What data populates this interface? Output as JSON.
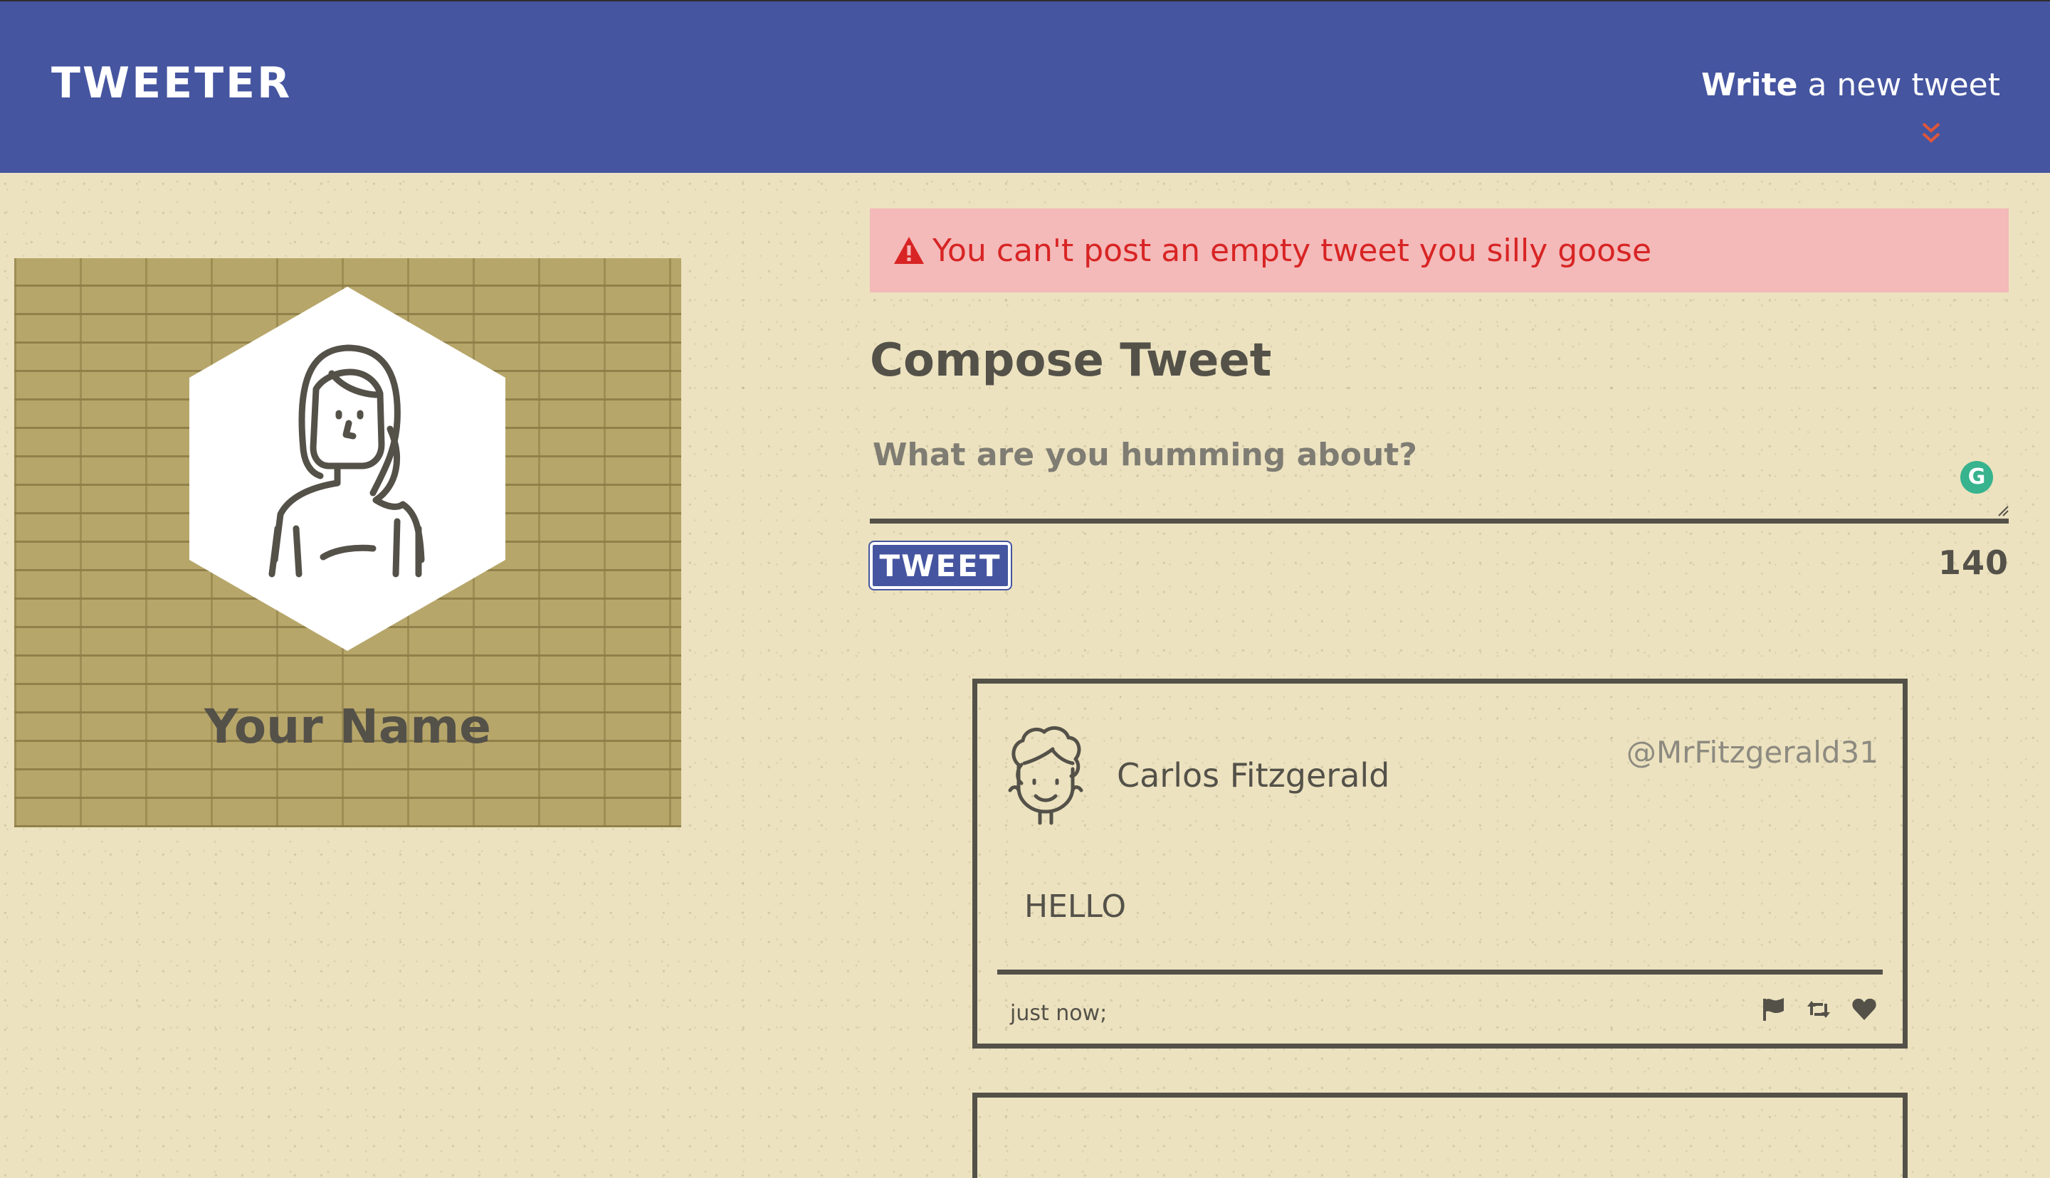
{
  "nav": {
    "brand": "TWEETER",
    "compose_bold": "Write",
    "compose_light": "a new tweet",
    "chevron_icon": "double-chevron-down-icon",
    "chevron_color": "#e0563a",
    "background_color": "#4555a0"
  },
  "profile": {
    "avatar_icon": "woman-avatar-icon",
    "name": "Your Name"
  },
  "alert": {
    "icon": "warning-triangle-icon",
    "message": "You can't post an empty tweet you silly goose",
    "text_color": "#d82424",
    "background_color": "#f4b9b9"
  },
  "compose": {
    "title": "Compose Tweet",
    "placeholder": "What are you humming about?",
    "value": "",
    "grammarly_icon": "G",
    "button_label": "TWEET",
    "counter": "140"
  },
  "tweets": [
    {
      "avatar_icon": "curly-hair-man-avatar-icon",
      "author": "Carlos Fitzgerald",
      "handle": "@MrFitzgerald31",
      "body": "HELLO",
      "time": "just now;",
      "actions": [
        "flag-icon",
        "retweet-icon",
        "heart-icon"
      ]
    }
  ]
}
